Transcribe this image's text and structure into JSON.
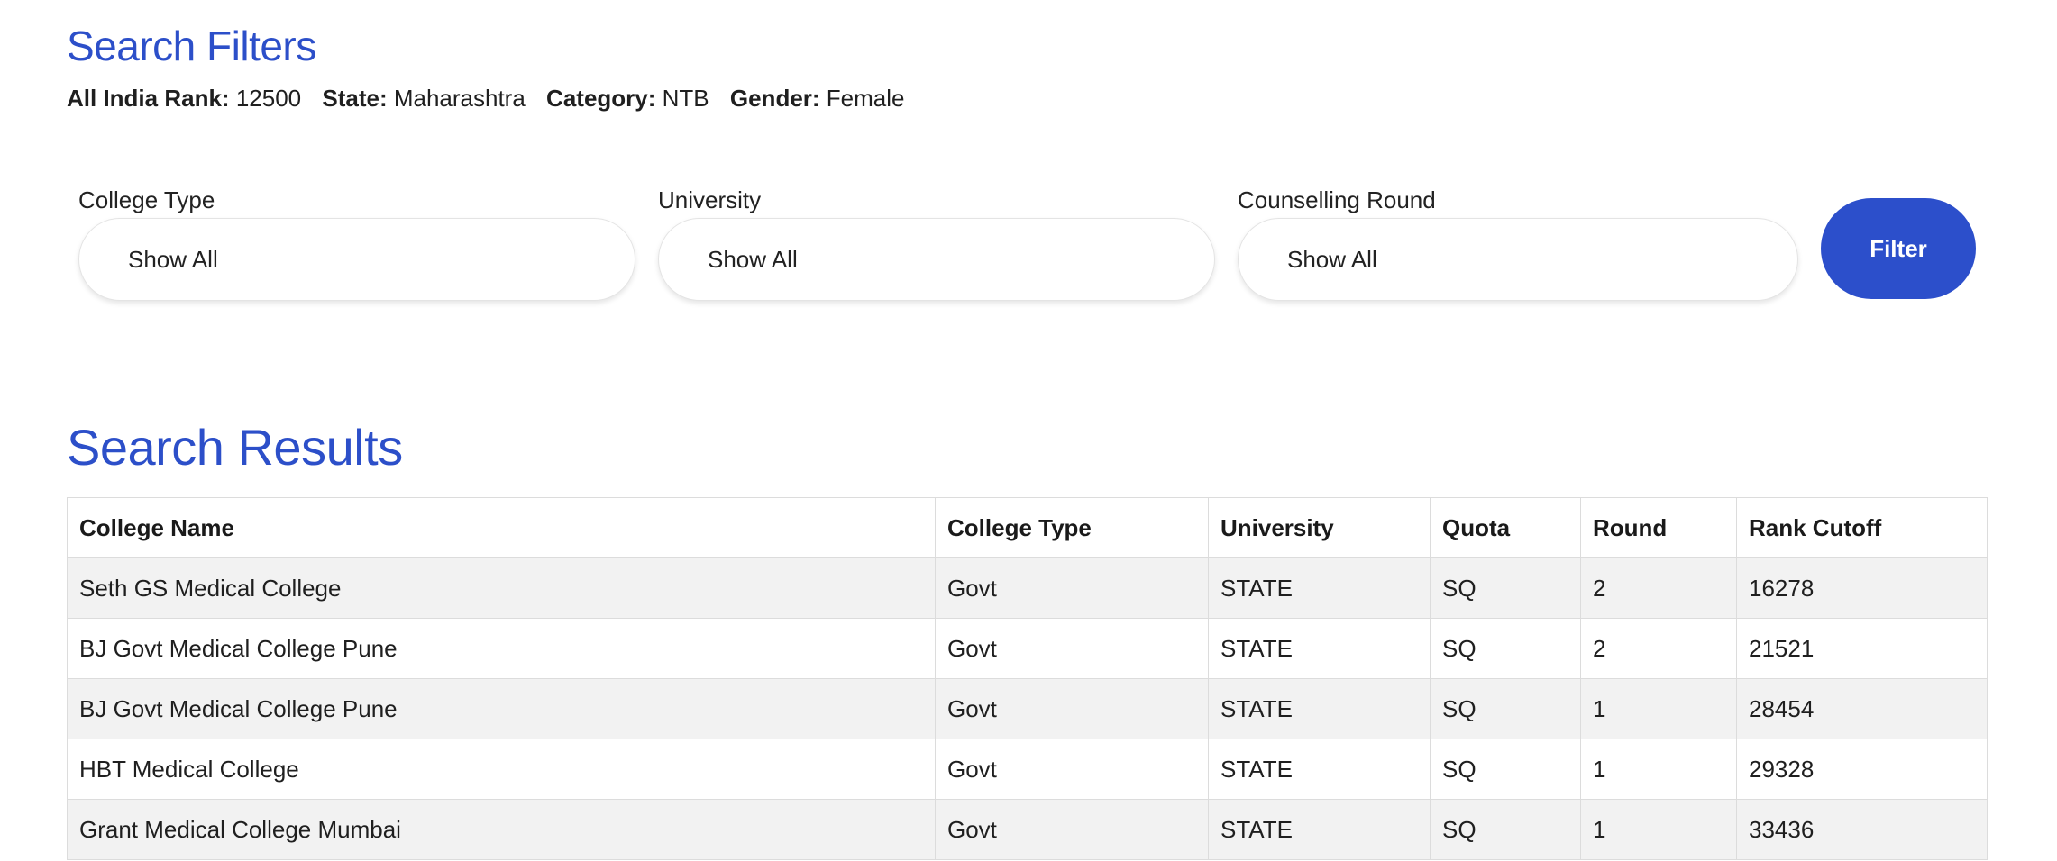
{
  "filters_title": "Search Filters",
  "summary": {
    "rank_label": "All India Rank:",
    "rank_value": "12500",
    "state_label": "State:",
    "state_value": "Maharashtra",
    "category_label": "Category:",
    "category_value": "NTB",
    "gender_label": "Gender:",
    "gender_value": "Female"
  },
  "filters": {
    "college_type": {
      "label": "College Type",
      "value": "Show All"
    },
    "university": {
      "label": "University",
      "value": "Show All"
    },
    "counselling_round": {
      "label": "Counselling Round",
      "value": "Show All"
    },
    "button_label": "Filter"
  },
  "results_title": "Search Results",
  "table": {
    "headers": [
      "College Name",
      "College Type",
      "University",
      "Quota",
      "Round",
      "Rank Cutoff"
    ],
    "rows": [
      [
        "Seth GS Medical College",
        "Govt",
        "STATE",
        "SQ",
        "2",
        "16278"
      ],
      [
        "BJ Govt Medical College Pune",
        "Govt",
        "STATE",
        "SQ",
        "2",
        "21521"
      ],
      [
        "BJ Govt Medical College Pune",
        "Govt",
        "STATE",
        "SQ",
        "1",
        "28454"
      ],
      [
        "HBT Medical College",
        "Govt",
        "STATE",
        "SQ",
        "1",
        "29328"
      ],
      [
        "Grant Medical College Mumbai",
        "Govt",
        "STATE",
        "SQ",
        "1",
        "33436"
      ]
    ]
  },
  "colors": {
    "accent": "#2c4fc9",
    "row_alt": "#f2f2f2"
  }
}
